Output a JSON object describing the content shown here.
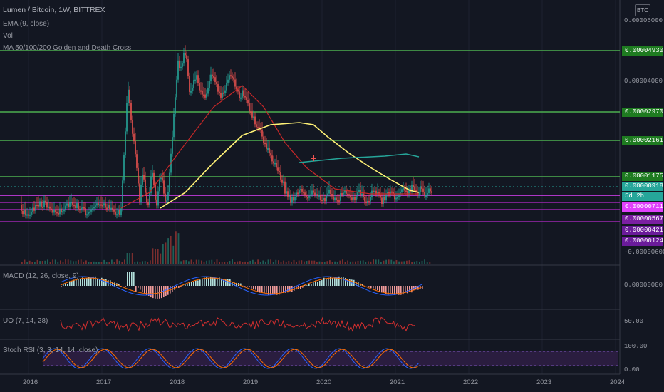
{
  "header": {
    "title": "Lumen / Bitcoin, 1W, BITTREX",
    "ema_label": "EMA (9, close)",
    "vol_label": "Vol",
    "ma_label": "MA 50/100/200 Golden and Death Cross",
    "currency_button": "BTC"
  },
  "price_axis": {
    "ticks": [
      "0.00006000",
      "0.00004000",
      "-0.00000600"
    ],
    "levels": [
      {
        "label": "0.00004930",
        "color": "#1e7b20",
        "line": "#4caf50"
      },
      {
        "label": "0.00002970",
        "color": "#1e7b20",
        "line": "#4caf50"
      },
      {
        "label": "0.00002161",
        "color": "#1e7b20",
        "line": "#4caf50"
      },
      {
        "label": "0.00001175",
        "color": "#1e7b20",
        "line": "#4caf50"
      },
      {
        "label": "0.00000918",
        "color": "#26a69a",
        "line": "#26a69a"
      },
      {
        "label": "5d 2h",
        "color": "#26a69a",
        "line": ""
      },
      {
        "label": "0.00000711",
        "color": "#e040fb",
        "line": "#e040fb"
      },
      {
        "label": "0.00000567",
        "color": "#7b1fa2",
        "line": "#9c27b0"
      },
      {
        "label": "0.00000421",
        "color": "#6a1b9a",
        "line": "#9c27b0"
      },
      {
        "label": "0.00000124",
        "color": "#6a1b9a",
        "line": "#9c27b0"
      }
    ]
  },
  "macd": {
    "label": "MACD (12, 26, close, 9)",
    "tick": "0.00000000"
  },
  "uo": {
    "label": "UO (7, 14, 28)",
    "tick": "50.00"
  },
  "stoch": {
    "label": "Stoch RSI (3, 3, 14, 14, close)",
    "ticks": [
      "100.00",
      "0.00"
    ]
  },
  "time_axis": [
    "2016",
    "2017",
    "2018",
    "2019",
    "2020",
    "2021",
    "2022",
    "2023",
    "2024"
  ],
  "colors": {
    "background": "#131722",
    "up": "#26a69a",
    "down": "#ef5350",
    "ma_red": "#c62828",
    "ma_yellow": "#fff176",
    "ma_teal": "#26a69a"
  }
}
